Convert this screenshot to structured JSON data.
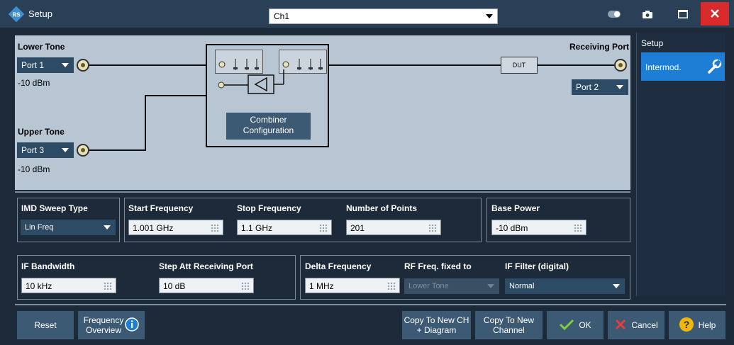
{
  "window": {
    "title": "Setup",
    "channel_select": "Ch1",
    "close_icon": "close-icon",
    "accent": "#1e7ed6",
    "close_color": "#d92b2b"
  },
  "diagram": {
    "lower_tone": {
      "label": "Lower Tone",
      "port": "Port 1",
      "power": "-10 dBm"
    },
    "upper_tone": {
      "label": "Upper Tone",
      "port": "Port 3",
      "power": "-10 dBm"
    },
    "receiving_port": {
      "label": "Receiving Port",
      "port": "Port 2"
    },
    "dut_label": "DUT",
    "combiner_button": "Combiner Configuration"
  },
  "sidebar": {
    "title": "Setup",
    "items": [
      {
        "label": "Intermod.",
        "icon": "wrench-icon"
      }
    ]
  },
  "imd": {
    "sweep_type": {
      "label": "IMD Sweep Type",
      "value": "Lin Freq"
    },
    "start_freq": {
      "label": "Start Frequency",
      "value": "1.001 GHz"
    },
    "stop_freq": {
      "label": "Stop Frequency",
      "value": "1.1 GHz"
    },
    "num_points": {
      "label": "Number of Points",
      "value": "201"
    },
    "base_power": {
      "label": "Base Power",
      "value": "-10 dBm"
    },
    "if_bandwidth": {
      "label": "IF Bandwidth",
      "value": "10 kHz"
    },
    "step_att": {
      "label": "Step Att Receiving Port",
      "value": "10 dB"
    },
    "delta_freq": {
      "label": "Delta Frequency",
      "value": "1 MHz"
    },
    "rf_fixed": {
      "label": "RF Freq. fixed to",
      "value": "Lower Tone"
    },
    "if_filter": {
      "label": "IF Filter (digital)",
      "value": "Normal"
    }
  },
  "buttons": {
    "reset": "Reset",
    "freq_overview": "Frequency Overview",
    "copy_ch_diagram": "Copy To New CH + Diagram",
    "copy_channel": "Copy To New Channel",
    "ok": "OK",
    "cancel": "Cancel",
    "help": "Help"
  }
}
